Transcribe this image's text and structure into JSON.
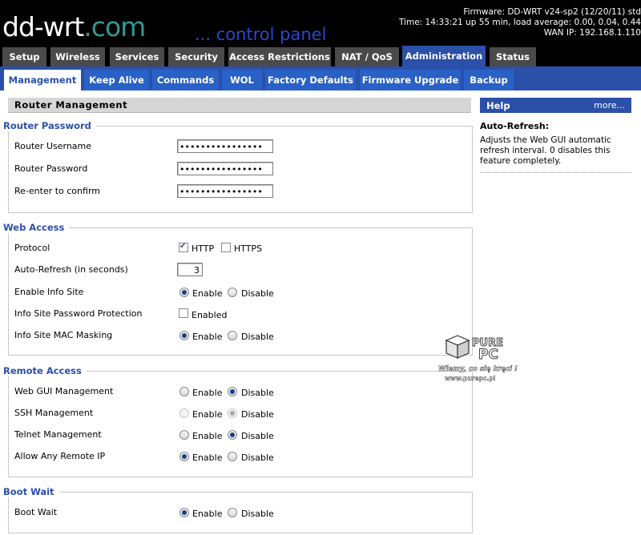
{
  "header": {
    "logo_main": "dd-wrt",
    "logo_suffix": ".com",
    "subtitle": "... control panel",
    "firmware": "Firmware: DD-WRT v24-sp2 (12/20/11) std",
    "time": "Time: 14:33:21 up 55 min, load average: 0.00, 0.04, 0.44",
    "wan_ip": "WAN IP: 192.168.1.110"
  },
  "tabs": [
    "Setup",
    "Wireless",
    "Services",
    "Security",
    "Access Restrictions",
    "NAT / QoS",
    "Administration",
    "Status"
  ],
  "subtabs": [
    "Management",
    "Keep Alive",
    "Commands",
    "WOL",
    "Factory Defaults",
    "Firmware Upgrade",
    "Backup"
  ],
  "page_title": "Router Management",
  "router_password": {
    "title": "Router Password",
    "username_label": "Router Username",
    "username_value": "••••••••••••••••",
    "password_label": "Router Password",
    "password_value": "••••••••••••••••",
    "confirm_label": "Re-enter to confirm",
    "confirm_value": "••••••••••••••••"
  },
  "web_access": {
    "title": "Web Access",
    "protocol_label": "Protocol",
    "http": "HTTP",
    "https": "HTTPS",
    "refresh_label": "Auto-Refresh (in seconds)",
    "refresh_value": "3",
    "info_site_label": "Enable Info Site",
    "info_pw_label": "Info Site Password Protection",
    "info_pw_enabled": "Enabled",
    "mac_label": "Info Site MAC Masking",
    "enable": "Enable",
    "disable": "Disable"
  },
  "remote_access": {
    "title": "Remote Access",
    "webgui_label": "Web GUI Management",
    "ssh_label": "SSH Management",
    "telnet_label": "Telnet Management",
    "anyip_label": "Allow Any Remote IP",
    "enable": "Enable",
    "disable": "Disable"
  },
  "boot_wait": {
    "title": "Boot Wait",
    "label": "Boot Wait",
    "enable": "Enable",
    "disable": "Disable"
  },
  "help": {
    "title": "Help",
    "more": "more...",
    "subtitle": "Auto-Refresh:",
    "text": "Adjusts the Web GUI automatic refresh interval. 0 disables this feature completely."
  },
  "watermark": {
    "line1": "PURE",
    "line2": "PC",
    "slogan": "Wiemy, co się kręci !",
    "url": "www.purepc.pl"
  },
  "colors": {
    "accent": "#2b50a9",
    "tab_inactive": "#4a4a4a",
    "subtab": "#2961c7",
    "logo_teal": "#2f9a8f",
    "cp_blue": "#2849c9"
  }
}
